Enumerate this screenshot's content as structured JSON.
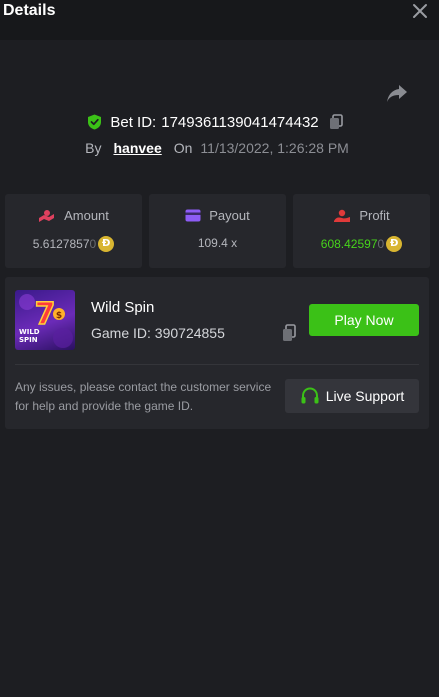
{
  "header": {
    "title": "Details"
  },
  "bet": {
    "label": "Bet ID:",
    "id": "1749361139041474432",
    "by_label": "By",
    "user": "hanvee",
    "on_label": "On",
    "timestamp": "11/13/2022, 1:26:28 PM"
  },
  "stats": {
    "amount": {
      "label": "Amount",
      "value": "5.61278570",
      "value_main": "5.6127857",
      "value_fade": "0"
    },
    "payout": {
      "label": "Payout",
      "value": "109.4 x"
    },
    "profit": {
      "label": "Profit",
      "value": "608.425970",
      "value_main": "608.42597",
      "value_fade": "0"
    },
    "coin_symbol": "Ɖ"
  },
  "game": {
    "name": "Wild Spin",
    "id_label": "Game ID:",
    "id": "390724855",
    "play_label": "Play Now",
    "thumb_text": "WILD SPIN",
    "thumb_number": "7"
  },
  "support": {
    "text": "Any issues, please contact the customer service for help and provide the game ID.",
    "button_label": "Live Support"
  },
  "colors": {
    "background": "#1d1e22",
    "card": "#26272c",
    "accent_green": "#3bc117",
    "profit_green": "#47d41b",
    "coin": "#d8b531",
    "amount_icon": "#e0415f",
    "payout_icon": "#8d5cf6",
    "profit_icon": "#e03a3a"
  }
}
